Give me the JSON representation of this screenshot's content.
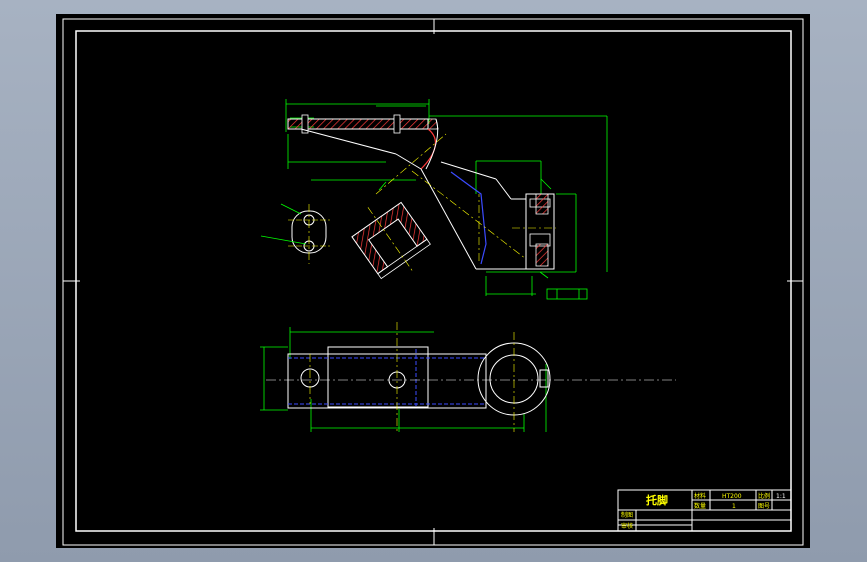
{
  "drawing": {
    "title": "托脚",
    "title_block": {
      "r1_label1": "材料",
      "r1_value1": "HT200",
      "r1_label2": "比例",
      "r1_value2": "1:1",
      "r2_label1": "数量",
      "r2_value1": "1",
      "r2_label2": "图号",
      "r3_label": "制图",
      "r4_label": "审核"
    },
    "colors": {
      "frame": "#ffffff",
      "dimension": "#00ff00",
      "centerline": "#ffff00",
      "hatch": "#ff3b3b",
      "hidden": "#3b4bff",
      "outline": "#ffffff"
    }
  }
}
